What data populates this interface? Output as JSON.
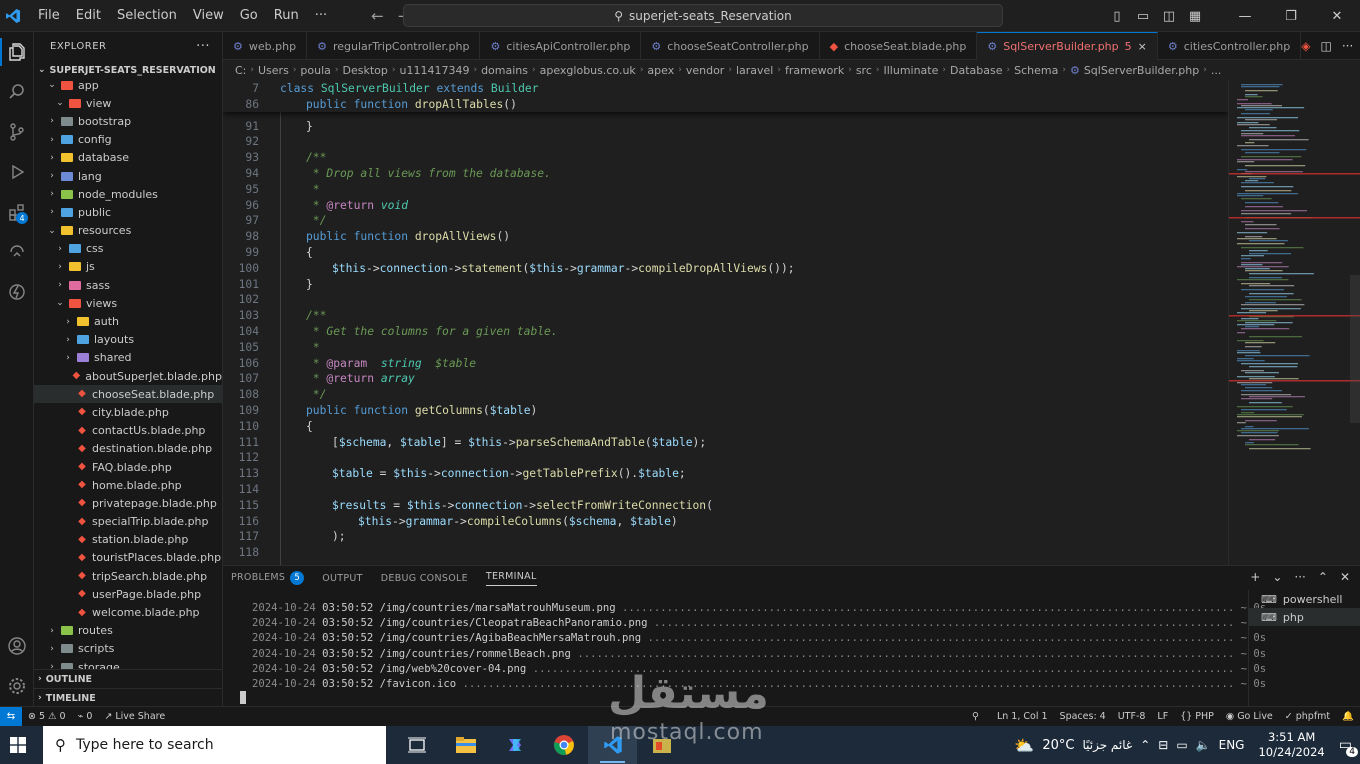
{
  "titlebar": {
    "menu": [
      "File",
      "Edit",
      "Selection",
      "View",
      "Go",
      "Run",
      "···"
    ],
    "search": "superjet-seats_Reservation"
  },
  "sidebar": {
    "header": "EXPLORER",
    "more": "···",
    "project": "SUPERJET-SEATS_RESERVATION",
    "rows": [
      {
        "label": "app",
        "depth": 1,
        "type": "folder",
        "open": true,
        "color": "#f05340"
      },
      {
        "label": "view",
        "depth": 2,
        "type": "folder",
        "open": true,
        "color": "#f05340"
      },
      {
        "label": "bootstrap",
        "depth": 1,
        "type": "folder",
        "open": false,
        "color": "#7f8c8d"
      },
      {
        "label": "config",
        "depth": 1,
        "type": "folder",
        "open": false,
        "color": "#4fa3e0"
      },
      {
        "label": "database",
        "depth": 1,
        "type": "folder",
        "open": false,
        "color": "#f2c12e"
      },
      {
        "label": "lang",
        "depth": 1,
        "type": "folder",
        "open": false,
        "color": "#6c8ad6"
      },
      {
        "label": "node_modules",
        "depth": 1,
        "type": "folder",
        "open": false,
        "color": "#8bc34a"
      },
      {
        "label": "public",
        "depth": 1,
        "type": "folder",
        "open": false,
        "color": "#4fa3e0"
      },
      {
        "label": "resources",
        "depth": 1,
        "type": "folder",
        "open": true,
        "color": "#f2c12e"
      },
      {
        "label": "css",
        "depth": 2,
        "type": "folder",
        "open": false,
        "color": "#4fa3e0"
      },
      {
        "label": "js",
        "depth": 2,
        "type": "folder",
        "open": false,
        "color": "#f2c12e"
      },
      {
        "label": "sass",
        "depth": 2,
        "type": "folder",
        "open": false,
        "color": "#e06c9f"
      },
      {
        "label": "views",
        "depth": 2,
        "type": "folder",
        "open": true,
        "color": "#f05340"
      },
      {
        "label": "auth",
        "depth": 3,
        "type": "folder",
        "open": false,
        "color": "#f2c12e"
      },
      {
        "label": "layouts",
        "depth": 3,
        "type": "folder",
        "open": false,
        "color": "#4fa3e0"
      },
      {
        "label": "shared",
        "depth": 3,
        "type": "folder",
        "open": false,
        "color": "#9c7fd6"
      },
      {
        "label": "aboutSuperJet.blade.php",
        "depth": 3,
        "type": "blade"
      },
      {
        "label": "chooseSeat.blade.php",
        "depth": 3,
        "type": "blade",
        "selected": true
      },
      {
        "label": "city.blade.php",
        "depth": 3,
        "type": "blade"
      },
      {
        "label": "contactUs.blade.php",
        "depth": 3,
        "type": "blade"
      },
      {
        "label": "destination.blade.php",
        "depth": 3,
        "type": "blade"
      },
      {
        "label": "FAQ.blade.php",
        "depth": 3,
        "type": "blade"
      },
      {
        "label": "home.blade.php",
        "depth": 3,
        "type": "blade"
      },
      {
        "label": "privatepage.blade.php",
        "depth": 3,
        "type": "blade"
      },
      {
        "label": "specialTrip.blade.php",
        "depth": 3,
        "type": "blade"
      },
      {
        "label": "station.blade.php",
        "depth": 3,
        "type": "blade"
      },
      {
        "label": "touristPlaces.blade.php",
        "depth": 3,
        "type": "blade"
      },
      {
        "label": "tripSearch.blade.php",
        "depth": 3,
        "type": "blade"
      },
      {
        "label": "userPage.blade.php",
        "depth": 3,
        "type": "blade"
      },
      {
        "label": "welcome.blade.php",
        "depth": 3,
        "type": "blade"
      },
      {
        "label": "routes",
        "depth": 1,
        "type": "folder",
        "open": false,
        "color": "#8bc34a"
      },
      {
        "label": "scripts",
        "depth": 1,
        "type": "folder",
        "open": false,
        "color": "#7f8c8d"
      },
      {
        "label": "storage",
        "depth": 1,
        "type": "folder",
        "open": false,
        "color": "#7f8c8d"
      }
    ],
    "outline": "OUTLINE",
    "timeline": "TIMELINE"
  },
  "tabs": [
    {
      "label": "web.php",
      "kind": "php"
    },
    {
      "label": "regularTripController.php",
      "kind": "php"
    },
    {
      "label": "citiesApiController.php",
      "kind": "php"
    },
    {
      "label": "chooseSeatController.php",
      "kind": "php"
    },
    {
      "label": "chooseSeat.blade.php",
      "kind": "blade"
    },
    {
      "label": "SqlServerBuilder.php",
      "kind": "php",
      "active": true,
      "problems": "5",
      "close": "×"
    },
    {
      "label": "citiesController.php",
      "kind": "php"
    }
  ],
  "breadcrumb": [
    "C:",
    "Users",
    "poula",
    "Desktop",
    "u111417349",
    "domains",
    "apexglobus.co.uk",
    "apex",
    "vendor",
    "laravel",
    "framework",
    "src",
    "Illuminate",
    "Database",
    "Schema",
    "SqlServerBuilder.php",
    "..."
  ],
  "sticky": [
    {
      "n": "7",
      "html": "<span class='kw'>class</span> <span class='cl'>SqlServerBuilder</span> <span class='kw'>extends</span> <span class='cl'>Builder</span>",
      "indent": 0
    },
    {
      "n": "86",
      "html": "<span class='kw'>public</span> <span class='kw'>function</span> <span class='fn'>dropAllTables</span><span class='op'>()</span>",
      "indent": 1
    }
  ],
  "code": [
    {
      "n": "91",
      "html": "<span class='op'>}</span>",
      "indent": 1
    },
    {
      "n": "92",
      "html": "",
      "indent": 0
    },
    {
      "n": "93",
      "html": "<span class='cm'>/**</span>",
      "indent": 1
    },
    {
      "n": "94",
      "html": "<span class='cm'> * Drop all views from the database.</span>",
      "indent": 1
    },
    {
      "n": "95",
      "html": "<span class='cm'> *</span>",
      "indent": 1
    },
    {
      "n": "96",
      "html": "<span class='cm'> * </span><span class='tp'>@return</span> <span class='cl' style='font-style:italic'>void</span>",
      "indent": 1
    },
    {
      "n": "97",
      "html": "<span class='cm'> */</span>",
      "indent": 1
    },
    {
      "n": "98",
      "html": "<span class='kw'>public</span> <span class='kw'>function</span> <span class='fn'>dropAllViews</span><span class='op'>()</span>",
      "indent": 1
    },
    {
      "n": "99",
      "html": "<span class='op'>{</span>",
      "indent": 1
    },
    {
      "n": "100",
      "html": "<span class='var'>$this</span><span class='op'>-></span><span class='var'>connection</span><span class='op'>-></span><span class='fn'>statement</span><span class='op'>(</span><span class='var'>$this</span><span class='op'>-></span><span class='var'>grammar</span><span class='op'>-></span><span class='fn'>compileDropAllViews</span><span class='op'>());</span>",
      "indent": 2
    },
    {
      "n": "101",
      "html": "<span class='op'>}</span>",
      "indent": 1
    },
    {
      "n": "102",
      "html": "",
      "indent": 0
    },
    {
      "n": "103",
      "html": "<span class='cm'>/**</span>",
      "indent": 1
    },
    {
      "n": "104",
      "html": "<span class='cm'> * Get the columns for a given table.</span>",
      "indent": 1
    },
    {
      "n": "105",
      "html": "<span class='cm'> *</span>",
      "indent": 1
    },
    {
      "n": "106",
      "html": "<span class='cm'> * </span><span class='tp'>@param</span>  <span class='cl' style='font-style:italic'>string</span>  <span class='cm'>$table</span>",
      "indent": 1
    },
    {
      "n": "107",
      "html": "<span class='cm'> * </span><span class='tp'>@return</span> <span class='cl' style='font-style:italic'>array</span>",
      "indent": 1
    },
    {
      "n": "108",
      "html": "<span class='cm'> */</span>",
      "indent": 1
    },
    {
      "n": "109",
      "html": "<span class='kw'>public</span> <span class='kw'>function</span> <span class='fn'>getColumns</span><span class='op'>(</span><span class='var'>$table</span><span class='op'>)</span>",
      "indent": 1
    },
    {
      "n": "110",
      "html": "<span class='op'>{</span>",
      "indent": 1
    },
    {
      "n": "111",
      "html": "<span class='op'>[</span><span class='var'>$schema</span><span class='op'>, </span><span class='var'>$table</span><span class='op'>] = </span><span class='var'>$this</span><span class='op'>-></span><span class='fn'>parseSchemaAndTable</span><span class='op'>(</span><span class='var'>$table</span><span class='op'>);</span>",
      "indent": 2
    },
    {
      "n": "112",
      "html": "",
      "indent": 0
    },
    {
      "n": "113",
      "html": "<span class='var'>$table</span><span class='op'> = </span><span class='var'>$this</span><span class='op'>-></span><span class='var'>connection</span><span class='op'>-></span><span class='fn'>getTablePrefix</span><span class='op'>().</span><span class='var'>$table</span><span class='op'>;</span>",
      "indent": 2
    },
    {
      "n": "114",
      "html": "",
      "indent": 0
    },
    {
      "n": "115",
      "html": "<span class='var'>$results</span><span class='op'> = </span><span class='var'>$this</span><span class='op'>-></span><span class='var'>connection</span><span class='op'>-></span><span class='fn'>selectFromWriteConnection</span><span class='op'>(</span>",
      "indent": 2
    },
    {
      "n": "116",
      "html": "<span class='var'>$this</span><span class='op'>-></span><span class='var'>grammar</span><span class='op'>-></span><span class='fn'>compileColumns</span><span class='op'>(</span><span class='var'>$schema</span><span class='op'>, </span><span class='var'>$table</span><span class='op'>)</span>",
      "indent": 3
    },
    {
      "n": "117",
      "html": "<span class='op'>);</span>",
      "indent": 2
    },
    {
      "n": "118",
      "html": "",
      "indent": 0
    }
  ],
  "panel": {
    "tabs": [
      "PROBLEMS",
      "OUTPUT",
      "DEBUG CONSOLE",
      "TERMINAL"
    ],
    "problems_count": "5",
    "active": "TERMINAL",
    "controls": [
      "+",
      "⌄",
      "···",
      "⌃",
      "✕"
    ],
    "terminal": [
      {
        "ts": "2024-10-24",
        "time": "03:50:52",
        "path": "/img/countries/marsaMatrouhMuseum.png",
        "dur": "~ 0s"
      },
      {
        "ts": "2024-10-24",
        "time": "03:50:52",
        "path": "/img/countries/CleopatraBeachPanoramio.png",
        "dur": "~ 0s"
      },
      {
        "ts": "2024-10-24",
        "time": "03:50:52",
        "path": "/img/countries/AgibaBeachMersaMatrouh.png",
        "dur": "~ 0s"
      },
      {
        "ts": "2024-10-24",
        "time": "03:50:52",
        "path": "/img/countries/rommelBeach.png",
        "dur": "~ 0s"
      },
      {
        "ts": "2024-10-24",
        "time": "03:50:52",
        "path": "/img/web%20cover-04.png",
        "dur": "~ 0s"
      },
      {
        "ts": "2024-10-24",
        "time": "03:50:52",
        "path": "/favicon.ico",
        "dur": "~ 0s"
      }
    ],
    "shells": [
      "powershell",
      "php"
    ]
  },
  "status": {
    "errors": "5",
    "warnings": "0",
    "ports": "0",
    "live_share": "Live Share",
    "position": "Ln 1, Col 1",
    "spaces": "Spaces: 4",
    "encoding": "UTF-8",
    "eol": "LF",
    "lang": "PHP",
    "golive": "Go Live",
    "fmt": "phpfmt"
  },
  "taskbar": {
    "search": "Type here to search",
    "weather": "20°C",
    "weather_text": "غائم جزئيًا",
    "lang": "ENG",
    "time": "3:51 AM",
    "date": "10/24/2024",
    "notif": "4"
  },
  "watermark": {
    "arabic": "مستقل",
    "latin": "mostaql.com"
  },
  "colors": {
    "accent": "#0078d4",
    "blade": "#f05340",
    "editor_bg": "#1f1f1f"
  }
}
